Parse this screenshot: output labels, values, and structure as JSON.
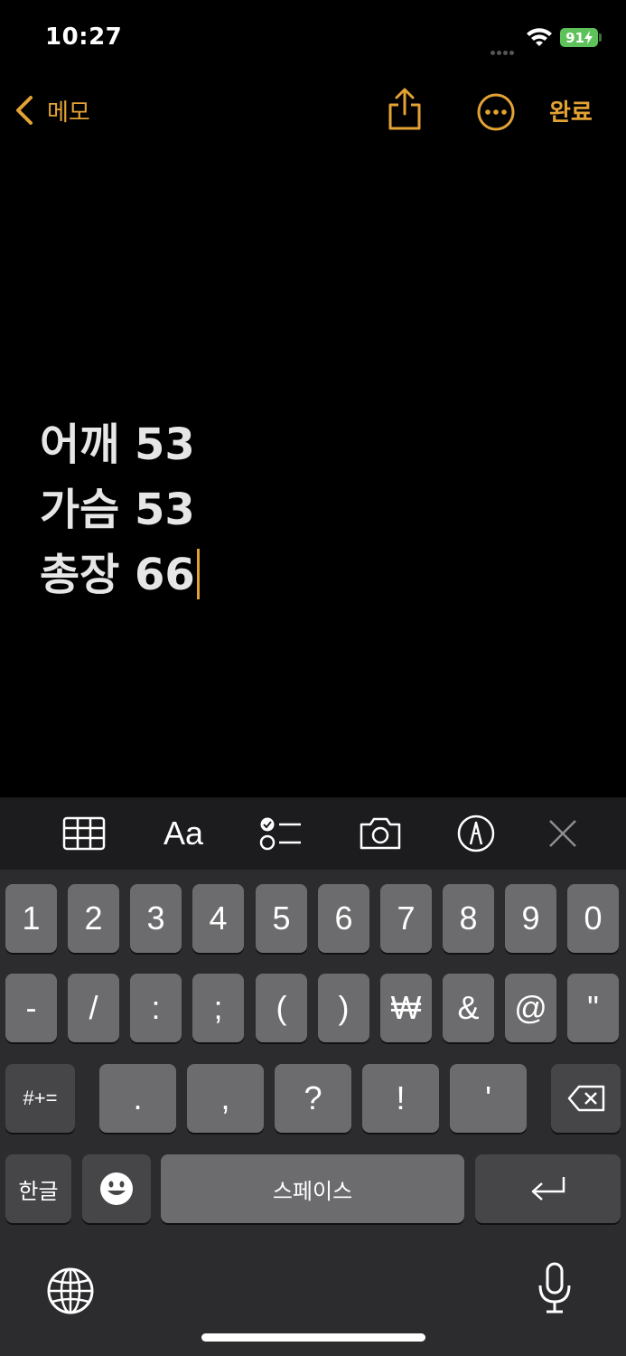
{
  "status_bar": {
    "time": "10:27",
    "battery": "91"
  },
  "nav": {
    "back_label": "메모",
    "done_label": "완료"
  },
  "note": {
    "lines": [
      "어깨 53",
      "가슴 53",
      "총장 66"
    ]
  },
  "toolbar": {
    "text_format_label": "Aa"
  },
  "keyboard": {
    "row1": [
      "1",
      "2",
      "3",
      "4",
      "5",
      "6",
      "7",
      "8",
      "9",
      "0"
    ],
    "row2": [
      "-",
      "/",
      ":",
      ";",
      "(",
      ")",
      "₩",
      "&",
      "@",
      "\""
    ],
    "row3": {
      "symbols_key": "#+=",
      "keys": [
        ".",
        ",",
        "?",
        "!",
        "'"
      ]
    },
    "row4": {
      "lang_key": "한글",
      "space_key": "스페이스"
    }
  },
  "colors": {
    "accent": "#e3a234",
    "battery": "#5ec25b",
    "keyboard_bg": "#2c2c2e",
    "key_bg": "#6c6c6e",
    "key_dark_bg": "#464648"
  },
  "icons": [
    "chevron-left-icon",
    "share-icon",
    "more-icon",
    "table-icon",
    "checklist-icon",
    "camera-icon",
    "markup-icon",
    "close-icon",
    "backspace-icon",
    "emoji-icon",
    "return-icon",
    "globe-icon",
    "microphone-icon",
    "wifi-icon"
  ]
}
